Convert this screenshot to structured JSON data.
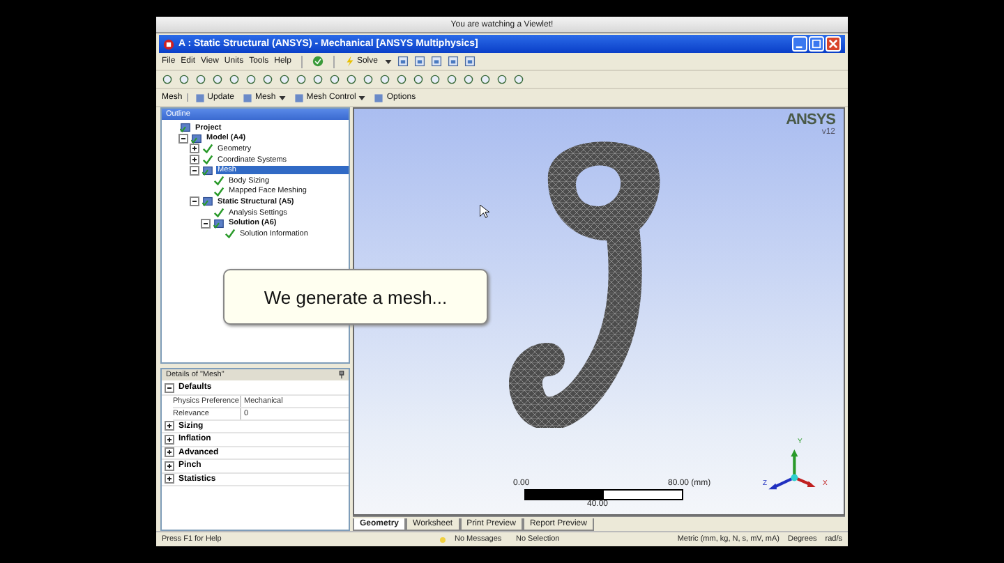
{
  "viewlet_bar": {
    "title": "You are watching a Viewlet!"
  },
  "window": {
    "title": "A : Static Structural (ANSYS) - Mechanical [ANSYS Multiphysics]"
  },
  "menu": [
    "File",
    "Edit",
    "View",
    "Units",
    "Tools",
    "Help"
  ],
  "solve_button": {
    "label": "Solve"
  },
  "context_toolbar": {
    "title": "Mesh",
    "buttons": [
      {
        "label": "Update",
        "kind": "plain"
      },
      {
        "label": "Mesh",
        "kind": "dropdown"
      },
      {
        "label": "Mesh Control",
        "kind": "dropdown"
      },
      {
        "label": "Options",
        "kind": "plain"
      }
    ]
  },
  "outline": {
    "title": "Outline",
    "tree": [
      {
        "label": "Project",
        "bold": true,
        "selected": false,
        "children": [
          {
            "label": "Model (A4)",
            "bold": true,
            "selected": false,
            "expanded": true,
            "children": [
              {
                "label": "Geometry",
                "bold": false,
                "selected": false,
                "expanded": false
              },
              {
                "label": "Coordinate Systems",
                "bold": false,
                "selected": false,
                "expanded": false
              },
              {
                "label": "Mesh",
                "bold": false,
                "selected": true,
                "expanded": true,
                "children": [
                  {
                    "label": "Body Sizing",
                    "bold": false,
                    "selected": false
                  },
                  {
                    "label": "Mapped Face Meshing",
                    "bold": false,
                    "selected": false
                  }
                ]
              },
              {
                "label": "Static Structural (A5)",
                "bold": true,
                "selected": false,
                "expanded": true,
                "children": [
                  {
                    "label": "Analysis Settings",
                    "bold": false,
                    "selected": false
                  },
                  {
                    "label": "Solution (A6)",
                    "bold": true,
                    "selected": false,
                    "expanded": true,
                    "children": [
                      {
                        "label": "Solution Information",
                        "bold": false,
                        "selected": false
                      }
                    ]
                  }
                ]
              }
            ]
          }
        ]
      }
    ]
  },
  "details": {
    "title": "Details of \"Mesh\"",
    "groups": [
      {
        "label": "Defaults",
        "expanded": true,
        "rows": [
          {
            "name": "Physics Preference",
            "value": "Mechanical"
          },
          {
            "name": "Relevance",
            "value": "0"
          }
        ]
      },
      {
        "label": "Sizing",
        "expanded": false
      },
      {
        "label": "Inflation",
        "expanded": false
      },
      {
        "label": "Advanced",
        "expanded": false
      },
      {
        "label": "Pinch",
        "expanded": false
      },
      {
        "label": "Statistics",
        "expanded": false
      }
    ]
  },
  "viewport": {
    "logo": "ANSYS",
    "version": "v12",
    "callout": "We generate a mesh...",
    "scale": {
      "start": "0.00",
      "end": "80.00 (mm)",
      "middle": "40.00"
    },
    "axes": [
      "Y",
      "Z",
      "X"
    ]
  },
  "tabs": [
    {
      "label": "Geometry",
      "selected": true
    },
    {
      "label": "Worksheet",
      "selected": false
    },
    {
      "label": "Print Preview",
      "selected": false
    },
    {
      "label": "Report Preview",
      "selected": false
    }
  ],
  "status_bar": {
    "help": "Press F1 for Help",
    "messages": "No Messages",
    "selection": "No Selection",
    "units": "Metric (mm, kg, N, s, mV, mA)",
    "angle": "Degrees",
    "rotation": "rad/s"
  }
}
